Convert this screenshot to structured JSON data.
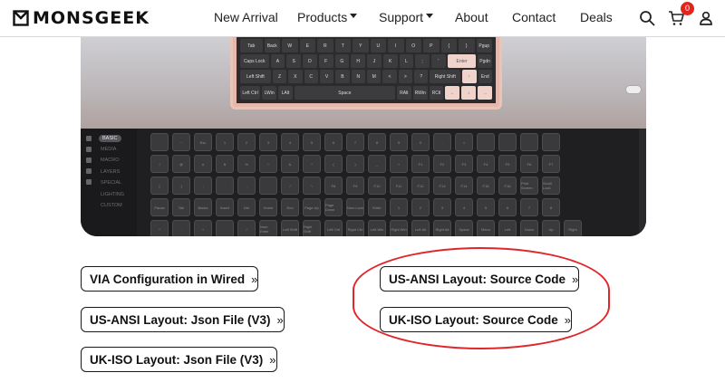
{
  "header": {
    "logo_text": "MONSGEEK",
    "nav": [
      {
        "label": "New Arrival",
        "has_caret": false
      },
      {
        "label": "Products",
        "has_caret": true
      },
      {
        "label": "Support",
        "has_caret": true
      },
      {
        "label": "About",
        "has_caret": false
      },
      {
        "label": "Contact",
        "has_caret": false
      },
      {
        "label": "Deals",
        "has_caret": false
      }
    ],
    "cart_count": "0",
    "icons": [
      "search-icon",
      "cart-icon",
      "user-icon"
    ]
  },
  "hero": {
    "keyboard_rows": [
      [
        "Tab",
        "Back",
        "W",
        "E",
        "R",
        "T",
        "Y",
        "U",
        "I",
        "O",
        "P",
        "{",
        "}",
        "Pgup"
      ],
      [
        "Caps Lock",
        "A",
        "S",
        "D",
        "F",
        "G",
        "H",
        "J",
        "K",
        "L",
        ";",
        "'",
        "Enter",
        "Pgdn"
      ],
      [
        "Left Shift",
        "Z",
        "X",
        "C",
        "V",
        "B",
        "N",
        "M",
        "<",
        ">",
        "?",
        "Right Shift",
        "↑",
        "End"
      ],
      [
        "Left Ctrl",
        "LWin",
        "LAlt",
        "Space",
        "RAlt",
        "RWin",
        "RCtl",
        "←",
        "↓",
        "→"
      ]
    ],
    "sidebar": [
      "BASIC",
      "MEDIA",
      "MACRO",
      "LAYERS",
      "SPECIAL",
      "LIGHTING",
      "CUSTOM"
    ],
    "grid_rows": [
      [
        "",
        "~",
        "Esc",
        "1",
        "2",
        "3",
        "4",
        "5",
        "6",
        "7",
        "8",
        "9",
        "0",
        "-",
        "=",
        "",
        "",
        "",
        ""
      ],
      [
        "!",
        "@",
        "#",
        "$",
        "%",
        "^",
        "&",
        "*",
        "(",
        ")",
        "_",
        "+",
        "F1",
        "F2",
        "F3",
        "F4",
        "F5",
        "F6",
        "F7"
      ],
      [
        "[",
        "]",
        ";",
        "'",
        ",",
        ".",
        "/",
        "\\",
        "F8",
        "F9",
        "F10",
        "F11",
        "F12",
        "F13",
        "F14",
        "F15",
        "F16",
        "Print Screen",
        "Scroll Lock"
      ],
      [
        "Pause",
        "Tab",
        "Backs",
        "Insert",
        "Del",
        "Home",
        "End",
        "Page Up",
        "Page Down",
        "Num Lock",
        "Enter",
        "1",
        "2",
        "3",
        "4",
        "5",
        "6",
        "7",
        "8"
      ],
      [
        "*",
        "-",
        "+",
        ".",
        "/",
        "Num Enter",
        "Left Shift",
        "Right Shift",
        "Left Ctrl",
        "Right Ctrl",
        "Left Win",
        "Right Win",
        "Left Alt",
        "Right Alt",
        "Space",
        "Menu",
        "Left",
        "Down",
        "Up",
        "Right"
      ]
    ]
  },
  "links": {
    "via": "VIA Configuration in Wired",
    "us_json": "US-ANSI Layout: Json File (V3)",
    "uk_json": "UK-ISO Layout: Json File (V3)",
    "us_source": "US-ANSI Layout: Source Code",
    "uk_source": "UK-ISO Layout: Source Code",
    "chevron": "»"
  },
  "colors": {
    "badge": "#e1251b",
    "annotation": "#e0262b",
    "accent_key": "#f0d4cc"
  }
}
